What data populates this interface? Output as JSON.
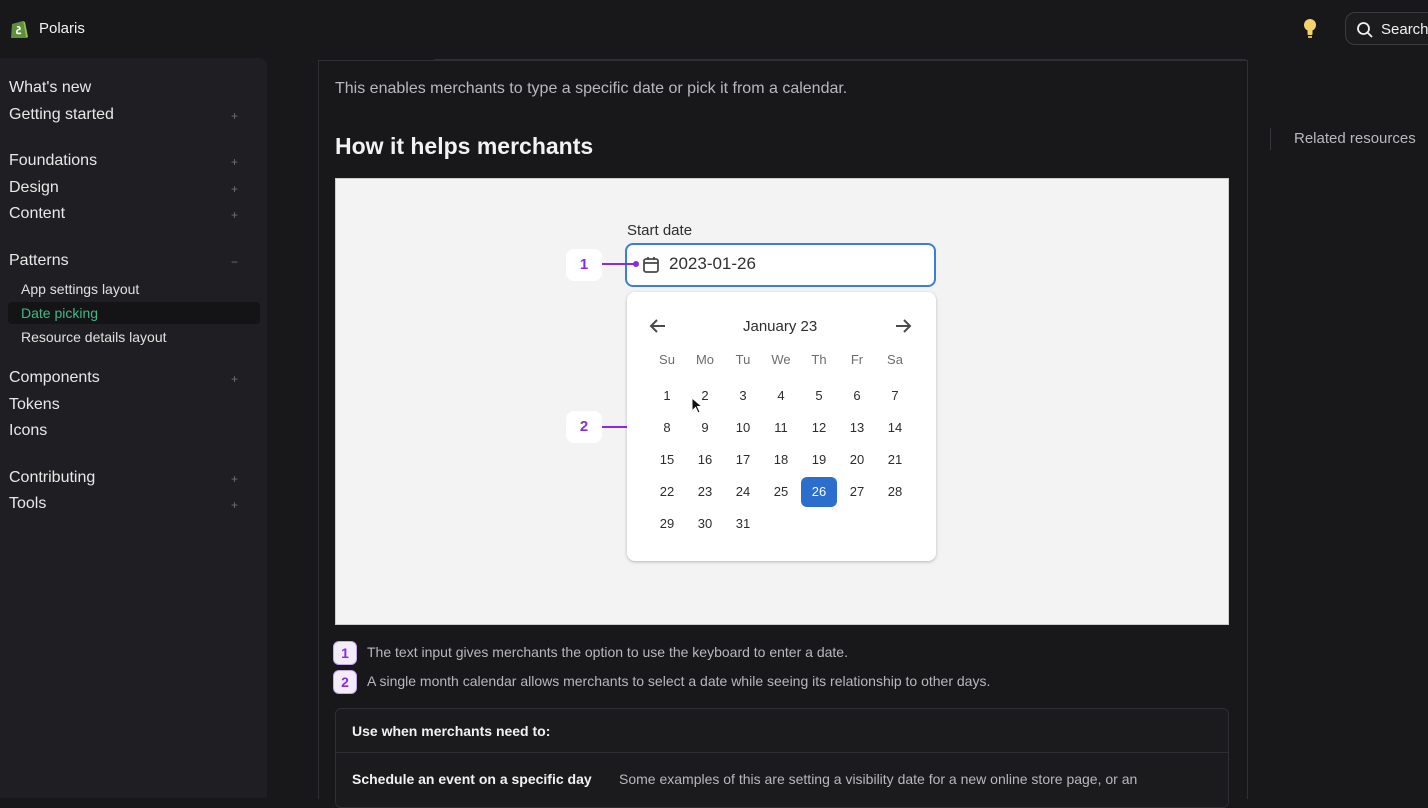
{
  "header": {
    "brand": "Polaris",
    "search_label": "Search"
  },
  "sidebar": {
    "items": [
      {
        "label": "What's new"
      },
      {
        "label": "Getting started",
        "toggle": "+"
      },
      {
        "label": "Foundations",
        "toggle": "+"
      },
      {
        "label": "Design",
        "toggle": "+"
      },
      {
        "label": "Content",
        "toggle": "+"
      },
      {
        "label": "Patterns",
        "toggle": "−"
      },
      {
        "label": "Components",
        "toggle": "+"
      },
      {
        "label": "Tokens"
      },
      {
        "label": "Icons"
      },
      {
        "label": "Contributing",
        "toggle": "+"
      },
      {
        "label": "Tools",
        "toggle": "+"
      }
    ],
    "patterns_children": [
      {
        "label": "App settings layout"
      },
      {
        "label": "Date picking",
        "active": true
      },
      {
        "label": "Resource details layout"
      }
    ],
    "active_color": "#3fb984"
  },
  "main": {
    "intro": "This enables merchants to type a specific date or pick it from a calendar.",
    "heading": "How it helps merchants",
    "figure": {
      "start_label": "Start date",
      "date_value": "2023-01-26",
      "callout_1": "1",
      "callout_2": "2",
      "calendar": {
        "month": "January 23",
        "weekdays": [
          "Su",
          "Mo",
          "Tu",
          "We",
          "Th",
          "Fr",
          "Sa"
        ],
        "weeks": [
          [
            "1",
            "2",
            "3",
            "4",
            "5",
            "6",
            "7"
          ],
          [
            "8",
            "9",
            "10",
            "11",
            "12",
            "13",
            "14"
          ],
          [
            "15",
            "16",
            "17",
            "18",
            "19",
            "20",
            "21"
          ],
          [
            "22",
            "23",
            "24",
            "25",
            "26",
            "27",
            "28"
          ],
          [
            "29",
            "30",
            "31"
          ]
        ],
        "selected_day": "26",
        "selected_color": "#2c6ecb"
      }
    },
    "legend": [
      {
        "num": "1",
        "text": "The text input gives merchants the option to use the keyboard to enter a date."
      },
      {
        "num": "2",
        "text": "A single month calendar allows merchants to select a date while seeing its relationship to other days."
      }
    ],
    "table": {
      "header": "Use when merchants need to:",
      "row_title": "Schedule an event on a specific day",
      "row_desc": "Some examples of this are setting a visibility date for a new online store page, or an"
    }
  },
  "aside": {
    "related": "Related resources"
  }
}
